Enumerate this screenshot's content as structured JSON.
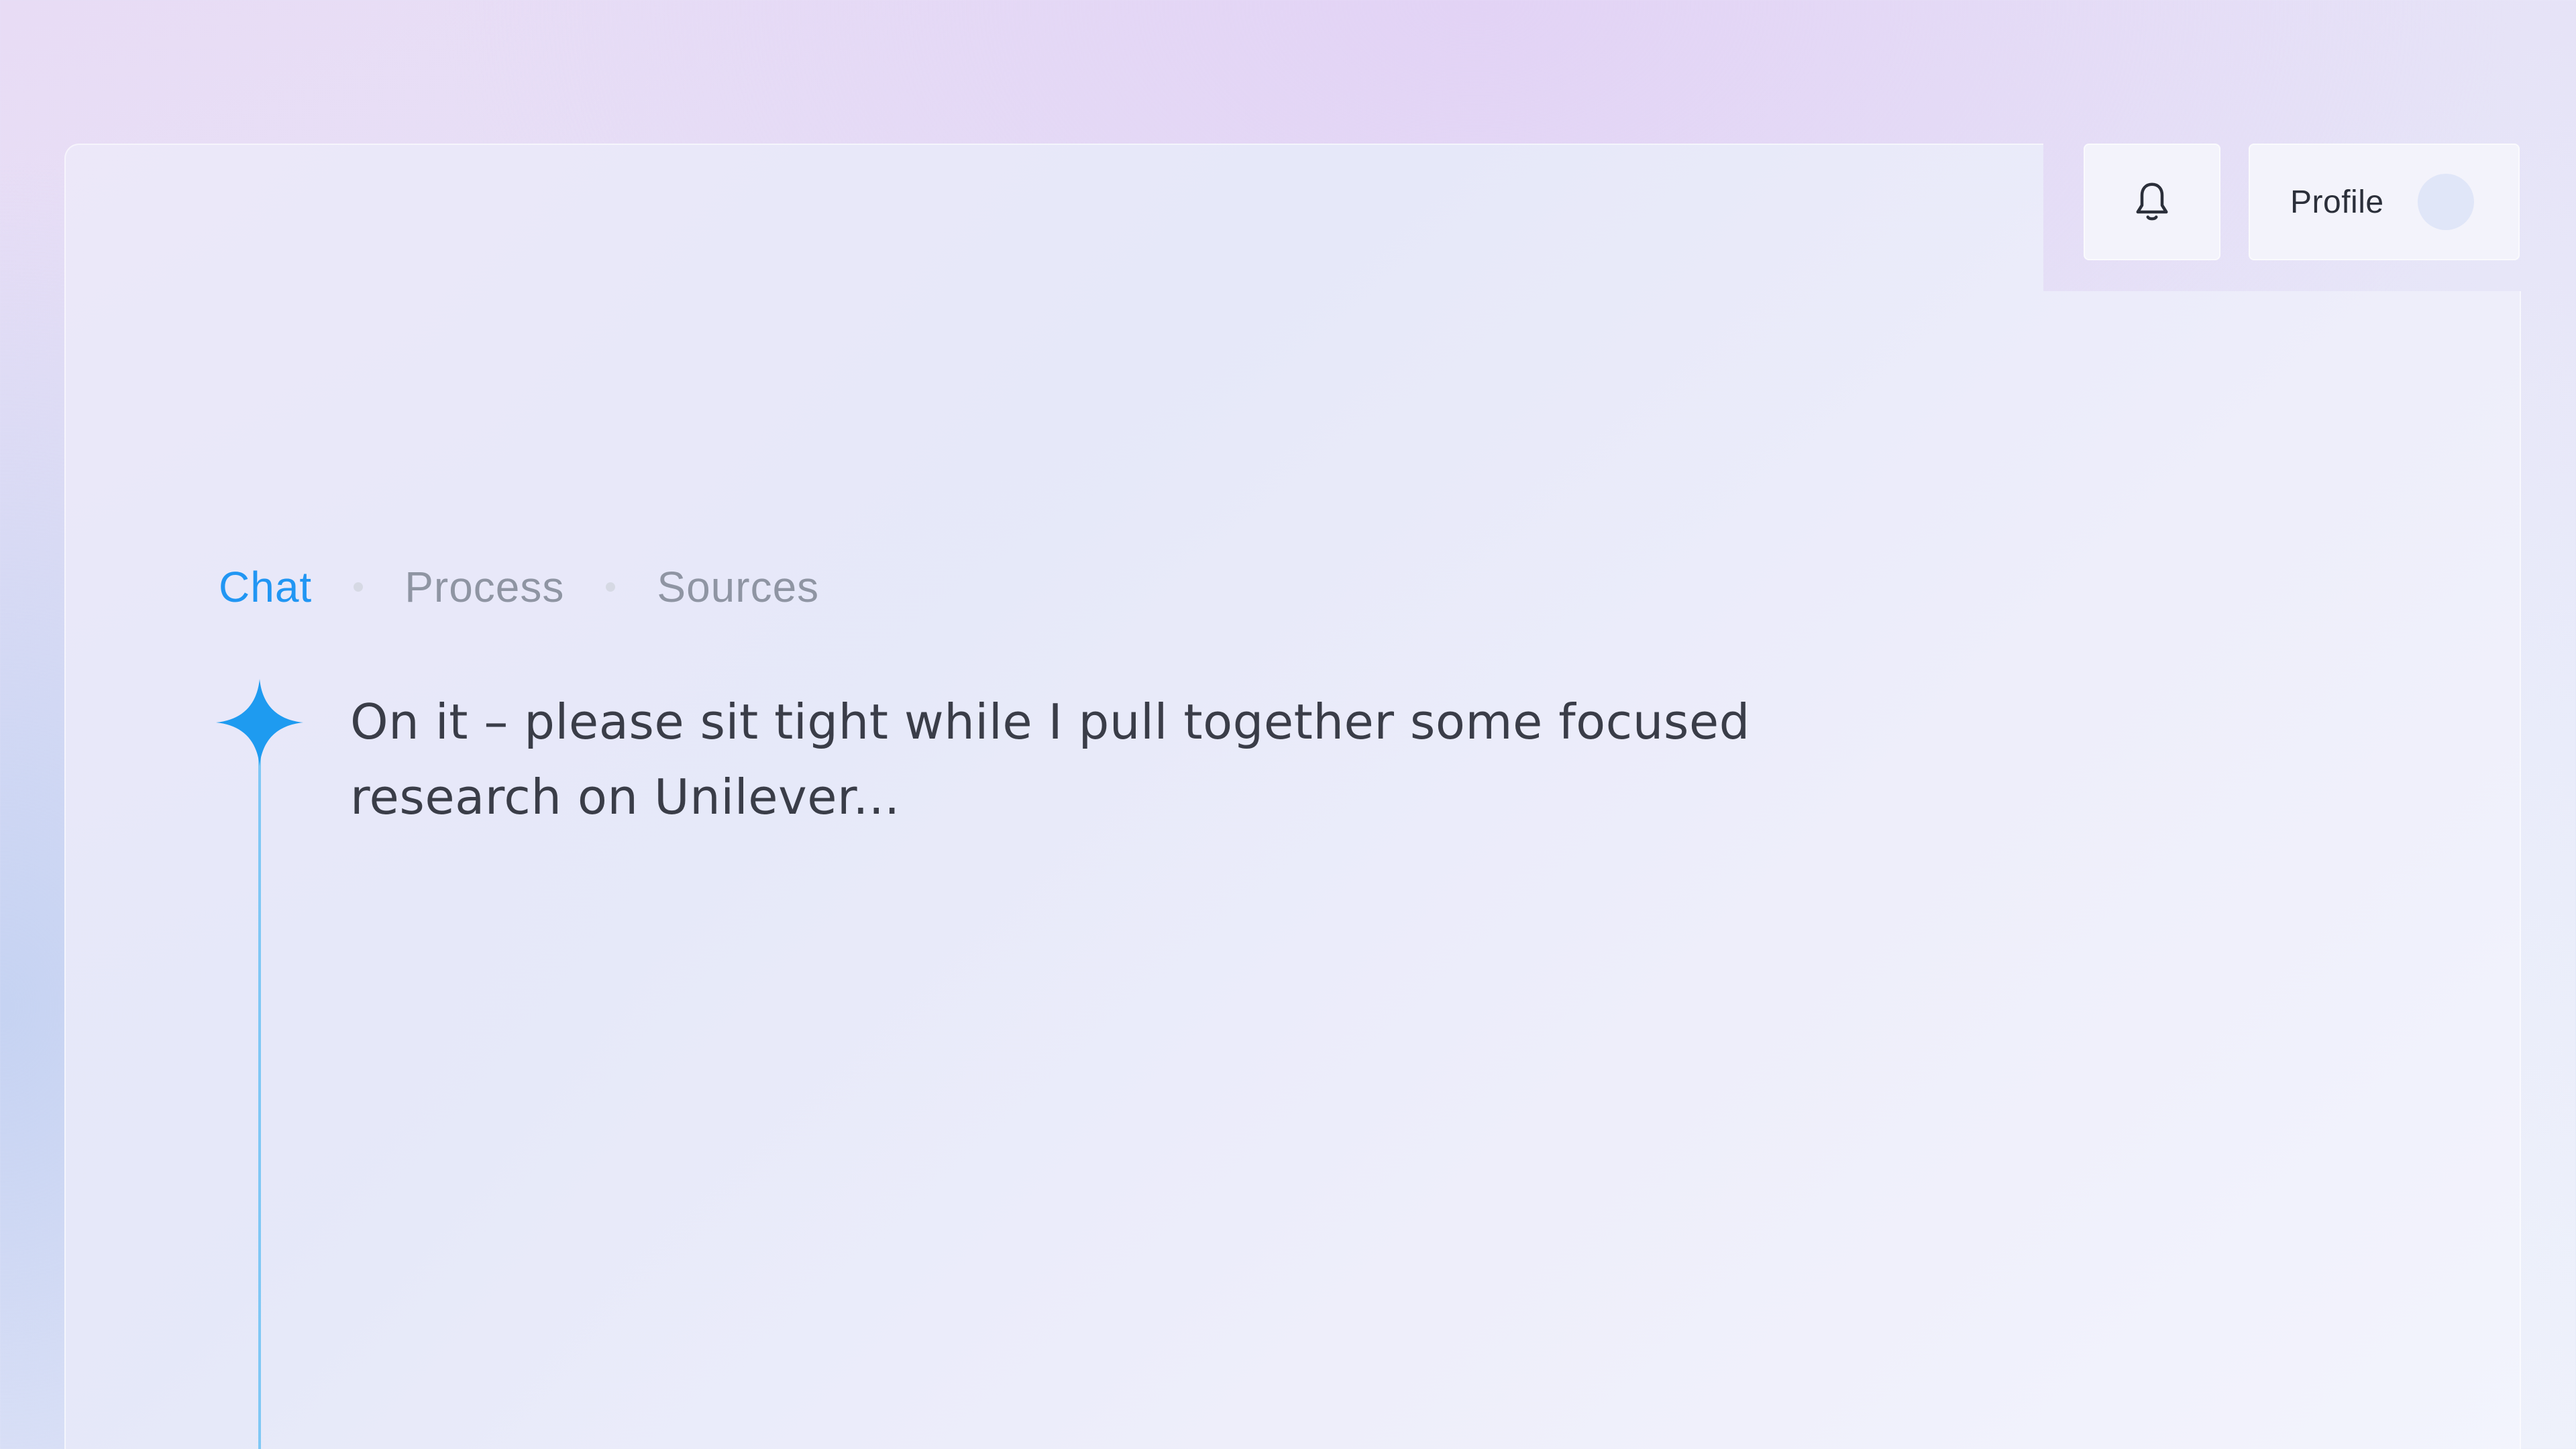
{
  "header": {
    "notifications_icon": "bell-icon",
    "profile_label": "Profile"
  },
  "tabs": [
    {
      "label": "Chat",
      "active": true
    },
    {
      "label": "Process",
      "active": false
    },
    {
      "label": "Sources",
      "active": false
    }
  ],
  "chat": {
    "assistant_icon": "sparkle-icon",
    "message": "On it – please sit tight while I pull together some focused research on Unilever..."
  },
  "colors": {
    "accent": "#2196f3",
    "timeline": "#7fc8f5",
    "text": "#3a3d48",
    "muted": "#8f95a3"
  }
}
